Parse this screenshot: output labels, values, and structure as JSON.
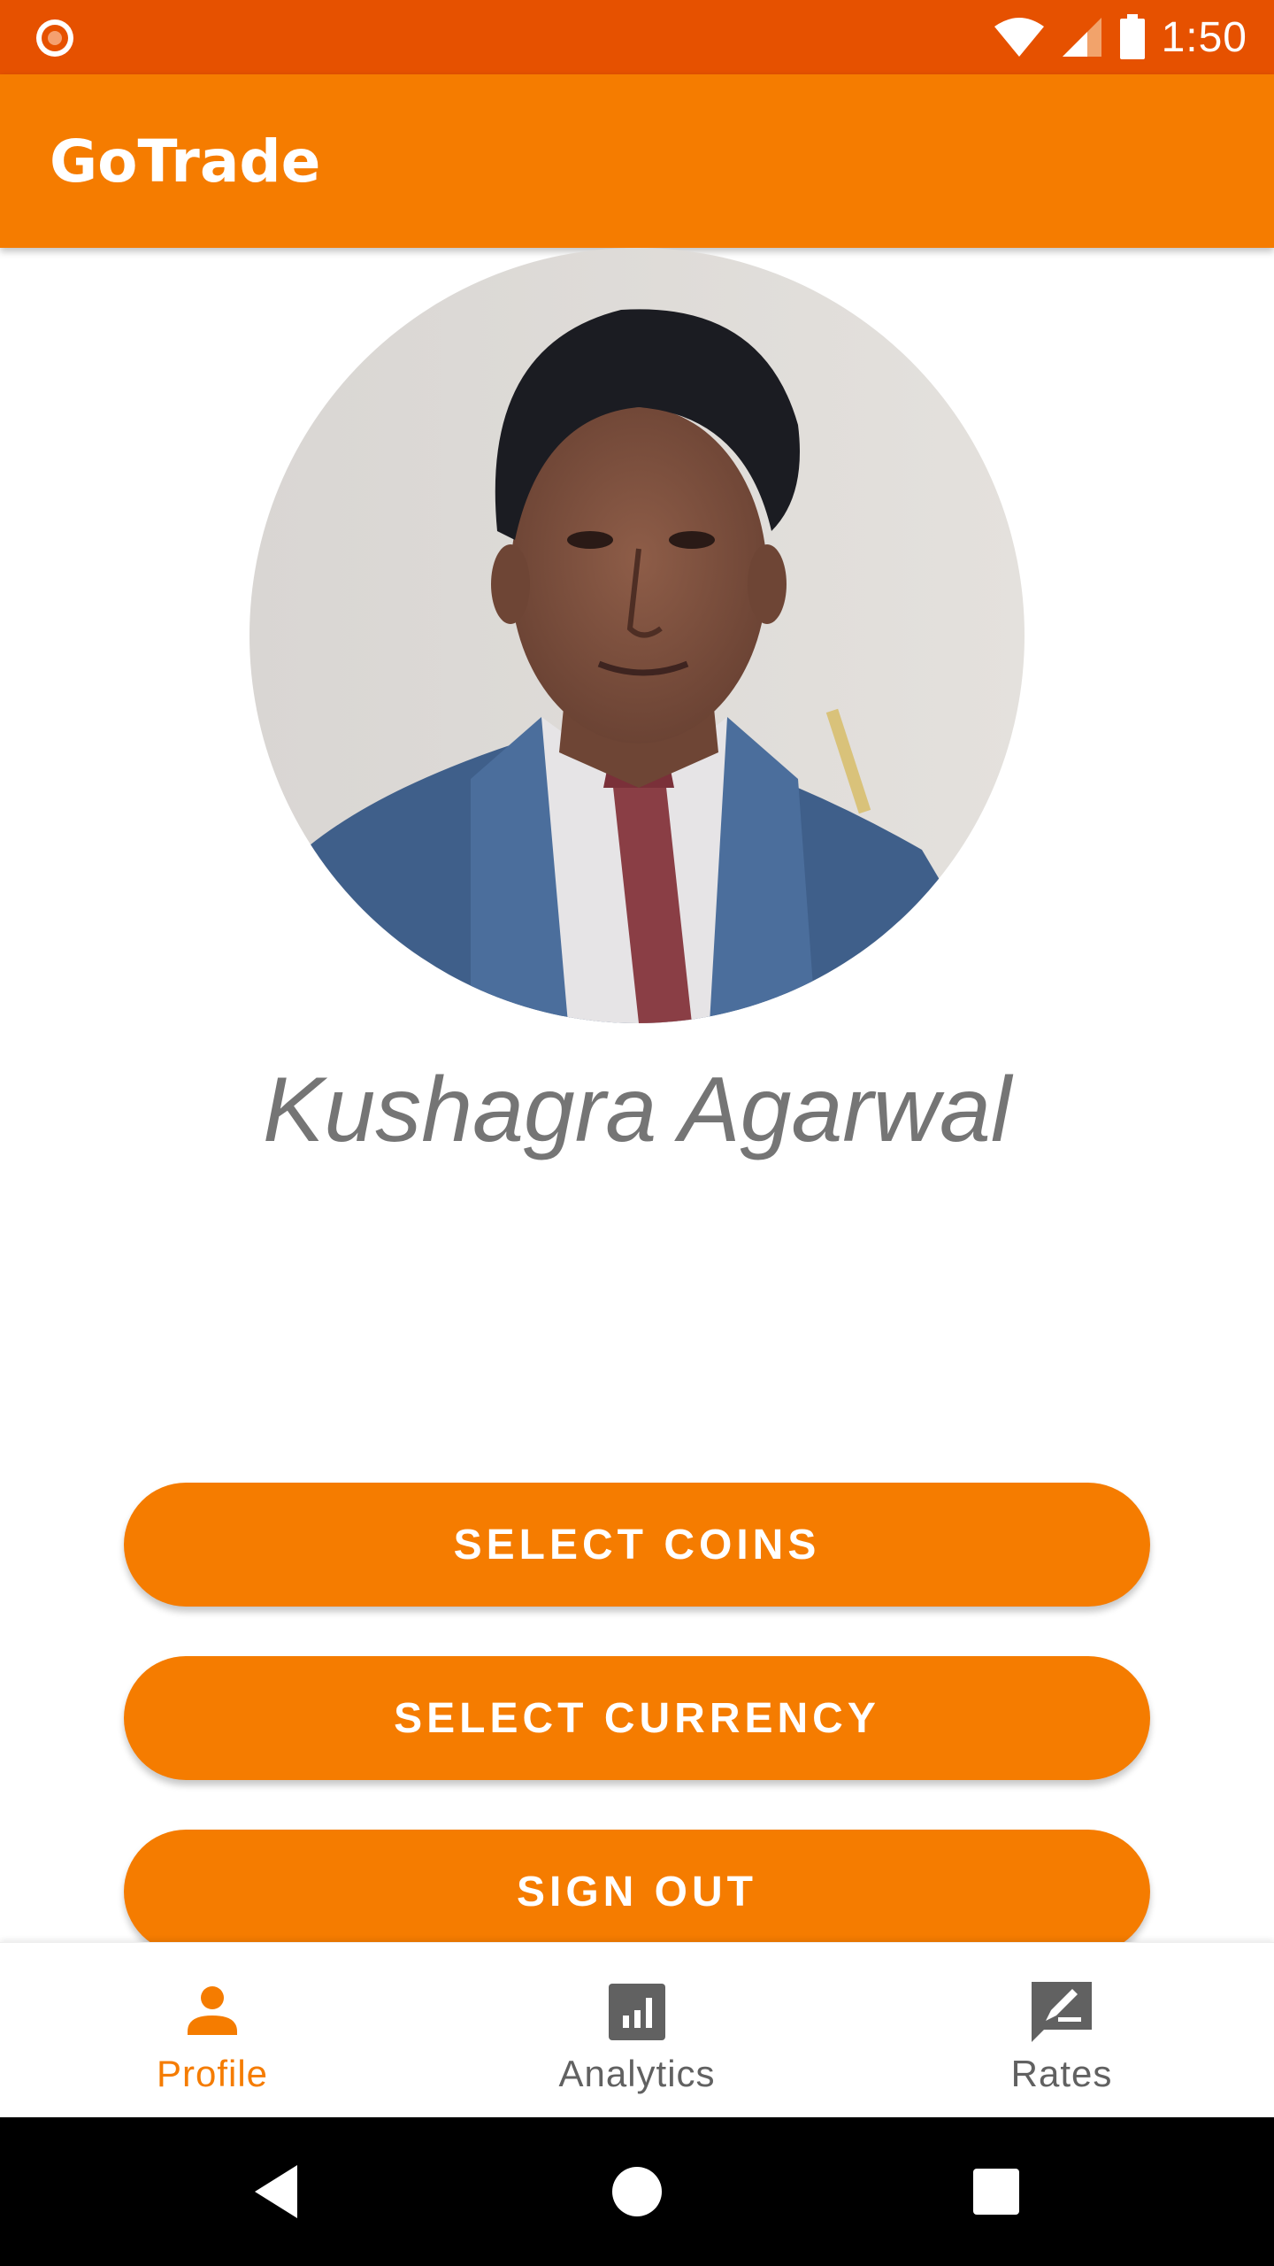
{
  "status_bar": {
    "time": "1:50",
    "icons": [
      "record-icon",
      "wifi-icon",
      "signal-icon",
      "battery-icon"
    ]
  },
  "app_bar": {
    "title": "GoTrade"
  },
  "profile": {
    "avatar": "profile-photo",
    "name": "Kushagra Agarwal"
  },
  "actions": {
    "select_coins": "SELECT COINS",
    "select_currency": "SELECT CURRENCY",
    "sign_out": "SIGN OUT"
  },
  "bottom_nav": {
    "items": [
      {
        "label": "Profile",
        "icon": "person-icon",
        "selected": true
      },
      {
        "label": "Analytics",
        "icon": "analytics-icon",
        "selected": false
      },
      {
        "label": "Rates",
        "icon": "rate-review-icon",
        "selected": false
      }
    ]
  },
  "system_nav": {
    "icons": [
      "back-icon",
      "home-icon",
      "recents-icon"
    ]
  },
  "colors": {
    "status_bar": "#E65100",
    "primary": "#F57C00",
    "name_text": "#757575",
    "nav_inactive": "#616161"
  }
}
